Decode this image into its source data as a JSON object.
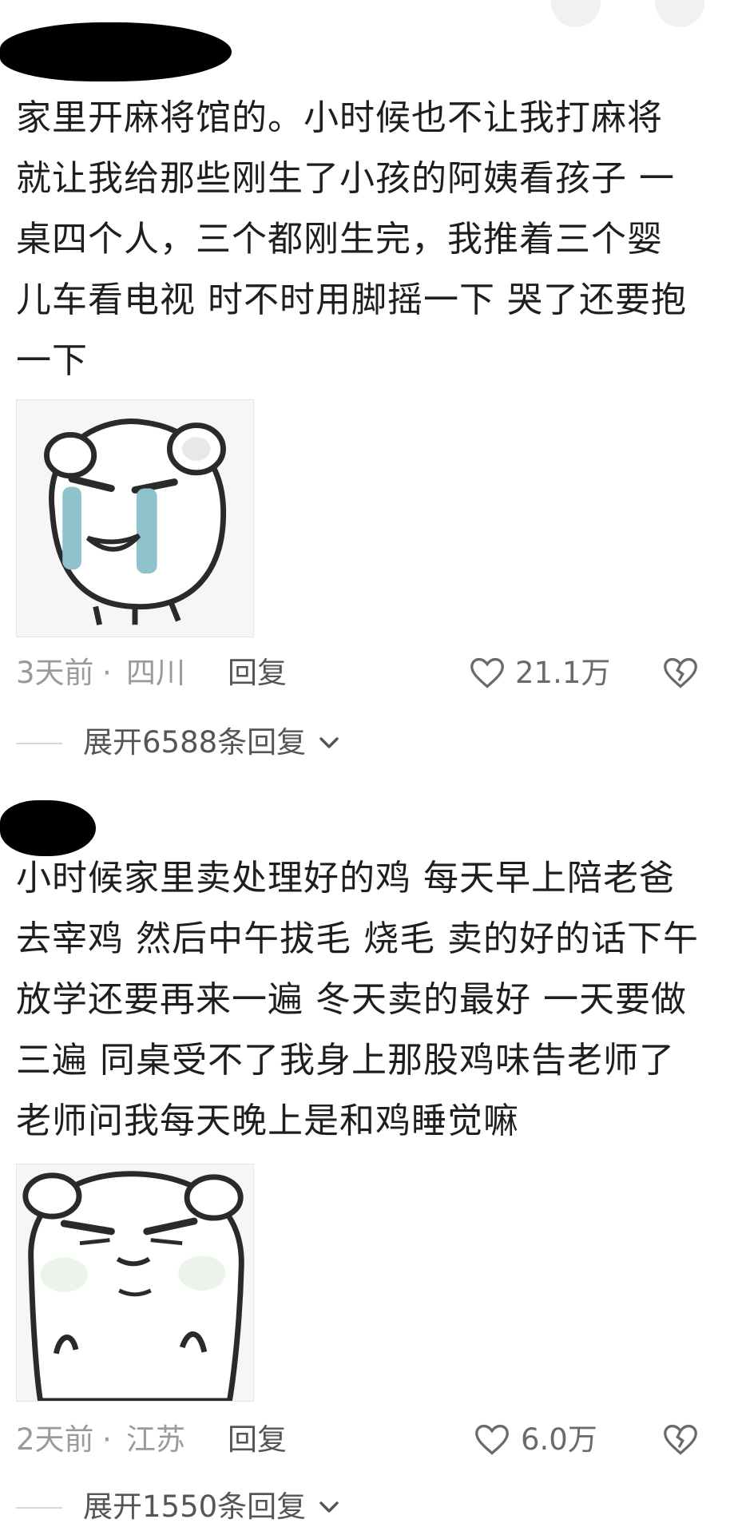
{
  "comments": [
    {
      "text": "家里开麻将馆的。小时候也不让我打麻将\n就让我给那些刚生了小孩的阿姨看孩子 一\n桌四个人，三个都刚生完，我推着三个婴\n儿车看电视 时不时用脚摇一下 哭了还要抱\n一下",
      "time": "3天前",
      "separator": "·",
      "location": "四川",
      "reply_label": "回复",
      "likes": "21.1万",
      "expand_label": "展开6588条回复",
      "sticker": "crying-bear-sticker"
    },
    {
      "text": "小时候家里卖处理好的鸡 每天早上陪老爸\n去宰鸡 然后中午拔毛 烧毛 卖的好的话下午\n放学还要再来一遍 冬天卖的最好 一天要做\n三遍 同桌受不了我身上那股鸡味告老师了\n老师问我每天晚上是和鸡睡觉嘛",
      "time": "2天前",
      "separator": "·",
      "location": "江苏",
      "reply_label": "回复",
      "likes": "6.0万",
      "expand_label": "展开1550条回复",
      "sticker": "grumpy-bear-sticker"
    }
  ],
  "colors": {
    "text": "#1e1e1e",
    "meta": "#9a9a9a",
    "redaction": "#000000",
    "tear": "#8fc3cc"
  }
}
